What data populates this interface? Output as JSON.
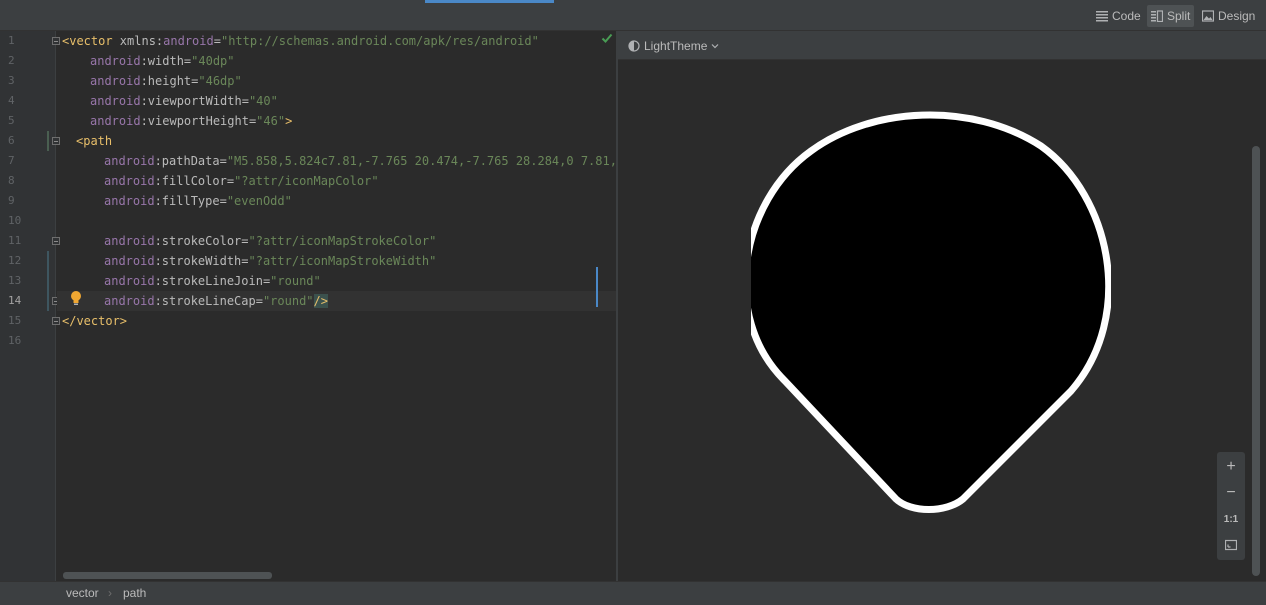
{
  "toolbar": {
    "views": [
      {
        "label": "Code",
        "icon": "lines-icon"
      },
      {
        "label": "Split",
        "icon": "split-icon",
        "active": true
      },
      {
        "label": "Design",
        "icon": "image-icon"
      }
    ]
  },
  "editor": {
    "line_numbers": [
      "1",
      "2",
      "3",
      "4",
      "5",
      "6",
      "7",
      "8",
      "9",
      "10",
      "11",
      "12",
      "13",
      "14",
      "15",
      "16"
    ],
    "current_line": "14",
    "lines": [
      {
        "segments": [
          [
            "tag",
            "<vector"
          ],
          [
            "attr",
            " xmlns:"
          ],
          [
            "ns",
            "android"
          ],
          [
            "attr",
            "="
          ],
          [
            "str",
            "\"http://schemas.android.com/apk/res/android\""
          ]
        ]
      },
      {
        "segments": [
          [
            "ns",
            "android"
          ],
          [
            "attr",
            ":width="
          ],
          [
            "str",
            "\"40dp\""
          ]
        ]
      },
      {
        "segments": [
          [
            "ns",
            "android"
          ],
          [
            "attr",
            ":height="
          ],
          [
            "str",
            "\"46dp\""
          ]
        ]
      },
      {
        "segments": [
          [
            "ns",
            "android"
          ],
          [
            "attr",
            ":viewportWidth="
          ],
          [
            "str",
            "\"40\""
          ]
        ]
      },
      {
        "segments": [
          [
            "ns",
            "android"
          ],
          [
            "attr",
            ":viewportHeight="
          ],
          [
            "str",
            "\"46\""
          ],
          [
            "tag",
            ">"
          ]
        ]
      },
      {
        "segments": [
          [
            "tag",
            "<path"
          ]
        ]
      },
      {
        "segments": [
          [
            "ns",
            "android"
          ],
          [
            "attr",
            ":pathData="
          ],
          [
            "str",
            "\"M5.858,5.824c7.81,-7.765 20.474,-7.765 28.284,0 7.81,7."
          ]
        ]
      },
      {
        "segments": [
          [
            "ns",
            "android"
          ],
          [
            "attr",
            ":fillColor="
          ],
          [
            "str",
            "\"?attr/iconMapColor\""
          ]
        ]
      },
      {
        "segments": [
          [
            "ns",
            "android"
          ],
          [
            "attr",
            ":fillType="
          ],
          [
            "str",
            "\"evenOdd\""
          ]
        ]
      },
      {
        "segments": []
      },
      {
        "segments": [
          [
            "ns",
            "android"
          ],
          [
            "attr",
            ":strokeColor="
          ],
          [
            "str",
            "\"?attr/iconMapStrokeColor\""
          ]
        ]
      },
      {
        "segments": [
          [
            "ns",
            "android"
          ],
          [
            "attr",
            ":strokeWidth="
          ],
          [
            "str",
            "\"?attr/iconMapStrokeWidth\""
          ]
        ]
      },
      {
        "segments": [
          [
            "ns",
            "android"
          ],
          [
            "attr",
            ":strokeLineJoin="
          ],
          [
            "str",
            "\"round\""
          ]
        ]
      },
      {
        "segments": [
          [
            "ns",
            "android"
          ],
          [
            "attr",
            ":strokeLineCap="
          ],
          [
            "str",
            "\"round\""
          ],
          [
            "tag",
            "/>"
          ]
        ]
      },
      {
        "segments": [
          [
            "tag",
            "</vector>"
          ]
        ]
      },
      {
        "segments": []
      }
    ]
  },
  "preview": {
    "theme": "LightTheme",
    "zoom_controls": {
      "zoom_in": "+",
      "zoom_out": "−",
      "actual_size": "1:1"
    }
  },
  "breadcrumb": {
    "items": [
      "vector",
      "path"
    ],
    "separator": "›"
  },
  "colors": {
    "accent": "#4a88c7",
    "pin_fill": "#000000",
    "pin_stroke": "#ffffff"
  }
}
